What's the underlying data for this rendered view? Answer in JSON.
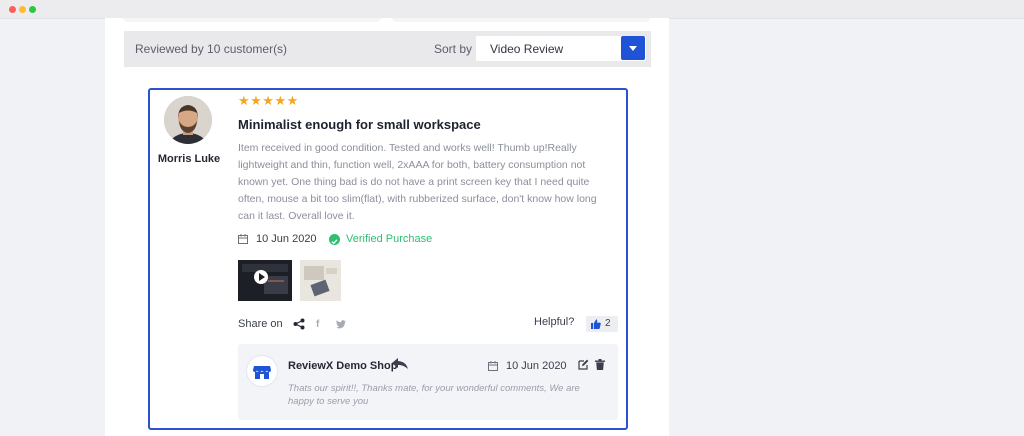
{
  "sort_bar": {
    "reviewed_text": "Reviewed by 10 customer(s)",
    "sort_label": "Sort by",
    "sort_value": "Video Review"
  },
  "review": {
    "author": "Morris Luke",
    "rating": 5,
    "stars": "★★★★★",
    "title": "Minimalist enough for small workspace",
    "body": "Item received in good condition. Tested and works well! Thumb up!Really lightweight and thin, function well, 2xAAA for both, battery consumption not known yet. One thing bad is do not have a print screen key that I need quite often, mouse a bit too slim(flat), with rubberized surface, don't know how long can it last. Overall love it.",
    "date": "10 Jun 2020",
    "verified": "Verified Purchase",
    "share_label": "Share on",
    "helpful_label": "Helpful?",
    "helpful_count": "2"
  },
  "reply": {
    "shop_name": "ReviewX Demo Shop",
    "date": "10 Jun 2020",
    "text": "Thats our spirit!!, Thanks mate, for your wonderful comments, We are happy to serve you"
  },
  "colors": {
    "accent": "#1f54d6",
    "card_border": "#2c52cf",
    "star": "#f5a623",
    "verified": "#2fbf71"
  },
  "icons": [
    "calendar-icon",
    "check-circle-icon",
    "share-icon",
    "facebook-icon",
    "twitter-icon",
    "thumbs-up-icon",
    "store-icon",
    "reply-arrow-icon",
    "edit-icon",
    "trash-icon",
    "play-icon"
  ]
}
